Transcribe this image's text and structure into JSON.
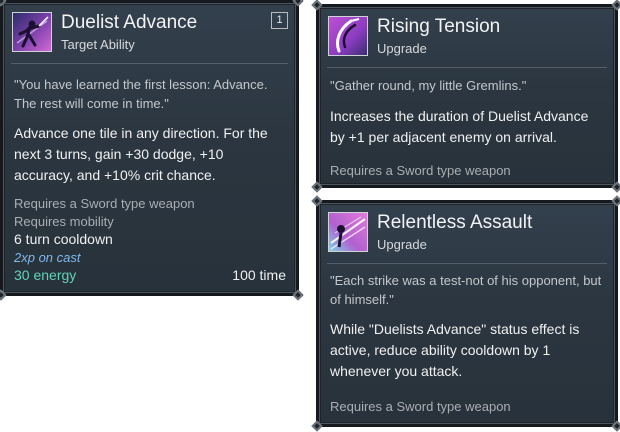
{
  "cards": [
    {
      "title": "Duelist Advance",
      "type": "Target Ability",
      "level": "1",
      "icon": "duelist-swordsman-icon",
      "quote": "\"You have learned the first lesson: Advance. The rest will come in time.\"",
      "description": "Advance one tile in any direction. For the next 3 turns, gain +30 dodge, +10 accuracy, and +10% crit chance.",
      "requirements": [
        "Requires a Sword type weapon",
        "Requires mobility"
      ],
      "cooldown": "6 turn cooldown",
      "xp": "2xp on cast",
      "energy": "30 energy",
      "time": "100 time"
    },
    {
      "title": "Rising Tension",
      "type": "Upgrade",
      "icon": "sword-slash-icon",
      "quote": "\"Gather round, my little Gremlins.\"",
      "description": "Increases the duration of Duelist Advance by +1 per adjacent enemy on arrival.",
      "requirement": "Requires a Sword type weapon"
    },
    {
      "title": "Relentless Assault",
      "type": "Upgrade",
      "icon": "flurry-strikes-icon",
      "quote": "\"Each strike was a test-not of his opponent, but of himself.\"",
      "description": "While \"Duelists Advance\" status effect is active, reduce ability cooldown by 1 whenever you attack.",
      "requirement": "Requires a Sword type weapon"
    }
  ],
  "colors": {
    "card_bg": "#2b3640",
    "energy": "#5fd3b8",
    "xp": "#7fb8ee",
    "icon_accent": "#c04fd6"
  }
}
